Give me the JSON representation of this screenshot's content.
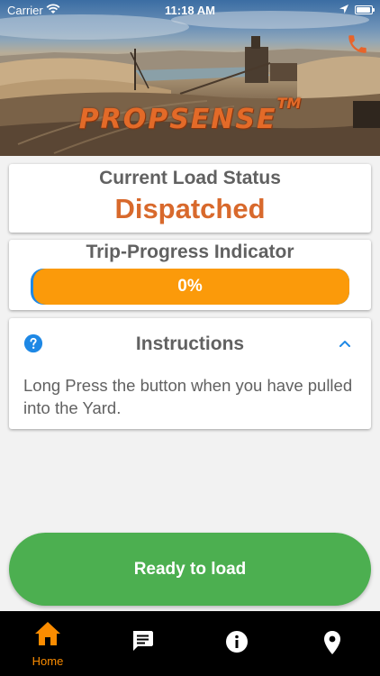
{
  "status_bar": {
    "carrier": "Carrier",
    "time": "11:18 AM"
  },
  "header": {
    "brand": "PROPSENSE",
    "trademark": "TM",
    "call_icon": "phone-icon"
  },
  "load_status": {
    "title": "Current Load Status",
    "value": "Dispatched"
  },
  "trip_progress": {
    "title": "Trip-Progress Indicator",
    "progress": 0,
    "label": "0%"
  },
  "instructions": {
    "title": "Instructions",
    "body": "Long Press the button when you have pulled into the Yard.",
    "expanded": true
  },
  "action": {
    "label": "Ready to load"
  },
  "bottom_nav": {
    "items": [
      {
        "label": "Home",
        "icon": "home-icon",
        "active": true
      },
      {
        "label": "",
        "icon": "chat-icon",
        "active": false
      },
      {
        "label": "",
        "icon": "info-icon",
        "active": false
      },
      {
        "label": "",
        "icon": "location-pin-icon",
        "active": false
      }
    ]
  },
  "colors": {
    "accent_orange": "#fb9a0a",
    "status_orange": "#d8692c",
    "success_green": "#4caf50",
    "help_blue": "#1e88e5",
    "nav_background": "#000000"
  }
}
